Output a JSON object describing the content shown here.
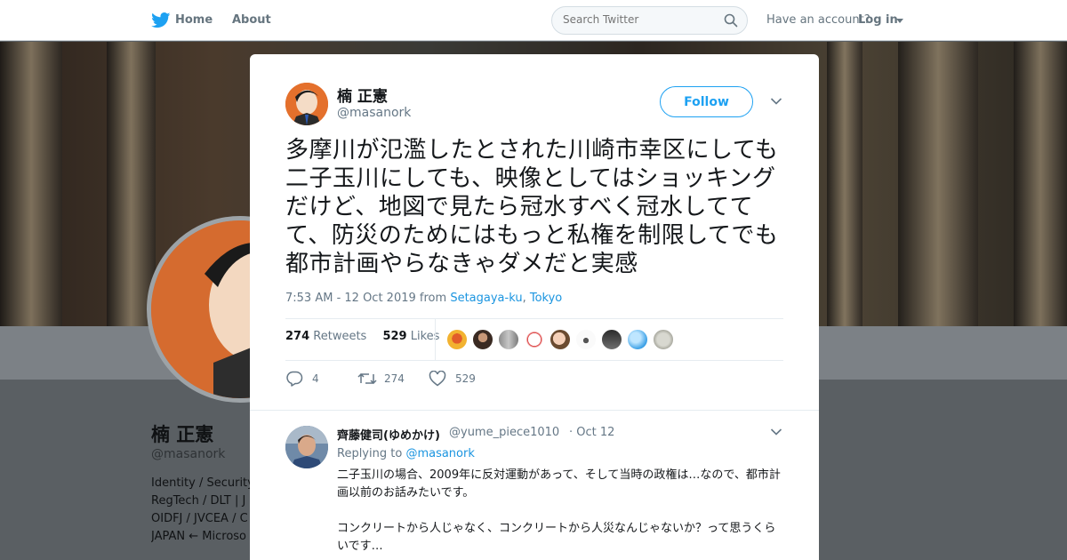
{
  "nav": {
    "home_label": "Home",
    "about_label": "About",
    "search_placeholder": "Search Twitter",
    "have_account": "Have an account?",
    "login_label": "Log in"
  },
  "colors": {
    "brand": "#1da1f2",
    "link": "#1b95e0",
    "muted": "#657786"
  },
  "profile": {
    "name": "楠 正憲",
    "handle": "@masanork",
    "bio_lines": [
      "Identity / Security",
      "RegTech / DLT | J",
      "OIDFJ / JVCEA / C",
      "JAPAN ← Microso"
    ]
  },
  "tweet": {
    "author_name": "楠 正憲",
    "author_handle": "@masanork",
    "follow_label": "Follow",
    "text": "多摩川が氾濫したとされた川崎市幸区にしても二子玉川にしても、映像としてはショッキングだけど、地図で見たら冠水すべく冠水しててて、防災のためにはもっと私権を制限してでも都市計画やらなきゃダメだと実感",
    "timestamp": "7:53 AM - 12 Oct 2019",
    "from_label": "from",
    "place_district": "Setagaya-ku",
    "place_sep": ",",
    "place_city": "Tokyo",
    "retweets_count": "274",
    "retweets_label": "Retweets",
    "likes_count": "529",
    "likes_label": "Likes",
    "actions": {
      "reply_count": "4",
      "retweet_count": "274",
      "like_count": "529"
    }
  },
  "reply": {
    "author_name": "齊藤健司(ゆめかけ)",
    "author_handle": "@yume_piece1010",
    "separator": "·",
    "date": "Oct 12",
    "replying_to_label": "Replying to",
    "replying_to_handle": "@masanork",
    "paragraphs": [
      "二子玉川の場合、2009年に反対運動があって、そして当時の政権は…なので、都市計画以前のお話みたいです。",
      "コンクリートから人じゃなく、コンクリートから人災なんじゃないか？って思うくらいです…"
    ]
  }
}
